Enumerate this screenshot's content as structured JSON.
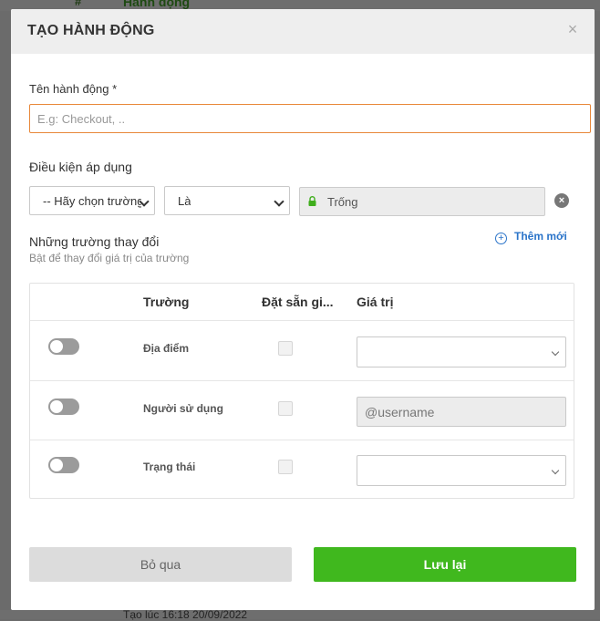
{
  "background": {
    "hash": "#",
    "column_title": "Hành động",
    "created_at": "Tạo lúc 16:18 20/09/2022"
  },
  "modal": {
    "title": "TẠO HÀNH ĐỘNG",
    "close_symbol": "×",
    "name_label": "Tên hành động *",
    "name_placeholder": "E.g: Checkout, ..",
    "condition_label": "Điều kiện áp dụng",
    "condition_field": "-- Hãy chọn trường --",
    "condition_operator": "Là",
    "condition_value": "Trống",
    "changes_title": "Những trường thay đổi",
    "changes_sub": "Bật để thay đổi giá trị của trường",
    "add_new": "Thêm mới",
    "table": {
      "headers": [
        "Trường",
        "Đặt sẵn gi...",
        "Giá trị"
      ],
      "rows": [
        {
          "field": "Địa điểm",
          "value_type": "select",
          "value": ""
        },
        {
          "field": "Người sử dụng",
          "value_type": "input",
          "value": "@username"
        },
        {
          "field": "Trạng thái",
          "value_type": "select",
          "value": ""
        }
      ]
    },
    "skip_label": "Bỏ qua",
    "save_label": "Lưu lại"
  },
  "colors": {
    "primary_green": "#40b81e",
    "link_blue": "#2b74c9",
    "input_focus_border": "#e8883a",
    "lock_green": "#3fae1c"
  },
  "icons": {
    "close": "close-icon",
    "lock": "lock-icon",
    "remove": "remove-circle-icon",
    "add": "plus-circle-icon",
    "dropdown": "chevron-down-icon"
  }
}
